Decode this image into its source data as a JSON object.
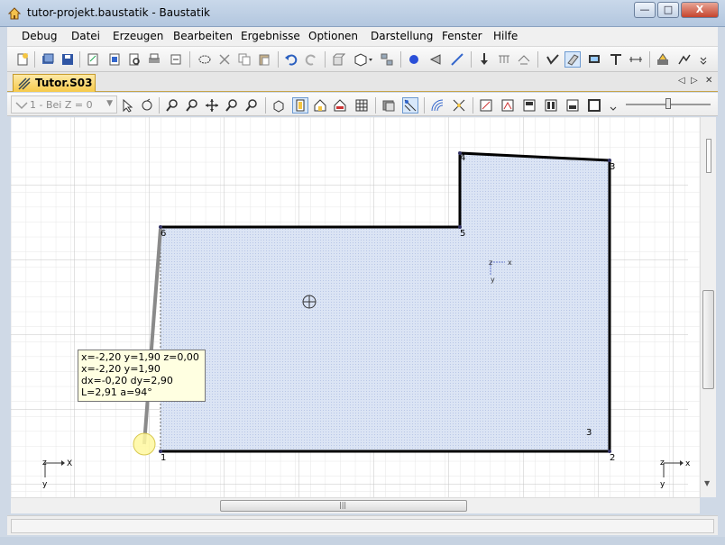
{
  "window": {
    "title": "tutor-projekt.baustatik - Baustatik",
    "minimize": "—",
    "maximize": "□",
    "close": "X"
  },
  "menu": [
    "Debug",
    "Datei",
    "Erzeugen",
    "Bearbeiten",
    "Ergebnisse",
    "Optionen",
    "Darstellung",
    "Fenster",
    "Hilfe"
  ],
  "tab": {
    "label": "Tutor.S03"
  },
  "layer_combo": {
    "value": "1 - Bei Z = 0"
  },
  "tooltip": {
    "lines": [
      "x=-2,20 y=1,90 z=0,00",
      "x=-2,20 y=1,90",
      "dx=-0,20 dy=2,90",
      "L=2,91 a=94°"
    ]
  },
  "nodes": [
    {
      "label": "1"
    },
    {
      "label": "2"
    },
    {
      "label": "3"
    },
    {
      "label": "4"
    },
    {
      "label": "5"
    },
    {
      "label": "6"
    }
  ],
  "region_label": "3",
  "axes": {
    "left": {
      "z": "z",
      "x": "X",
      "y": "y"
    },
    "right": {
      "z": "z",
      "x": "x",
      "y": "y"
    },
    "local": {
      "z": "z",
      "x": "x",
      "y": "y"
    }
  },
  "colors": {
    "region_fill": "#dbe4f4",
    "outline": "#000000",
    "grid_major": "#c8c8c8",
    "grid_minor": "#e6e6e6",
    "tab_bg": "#f6c94a"
  }
}
